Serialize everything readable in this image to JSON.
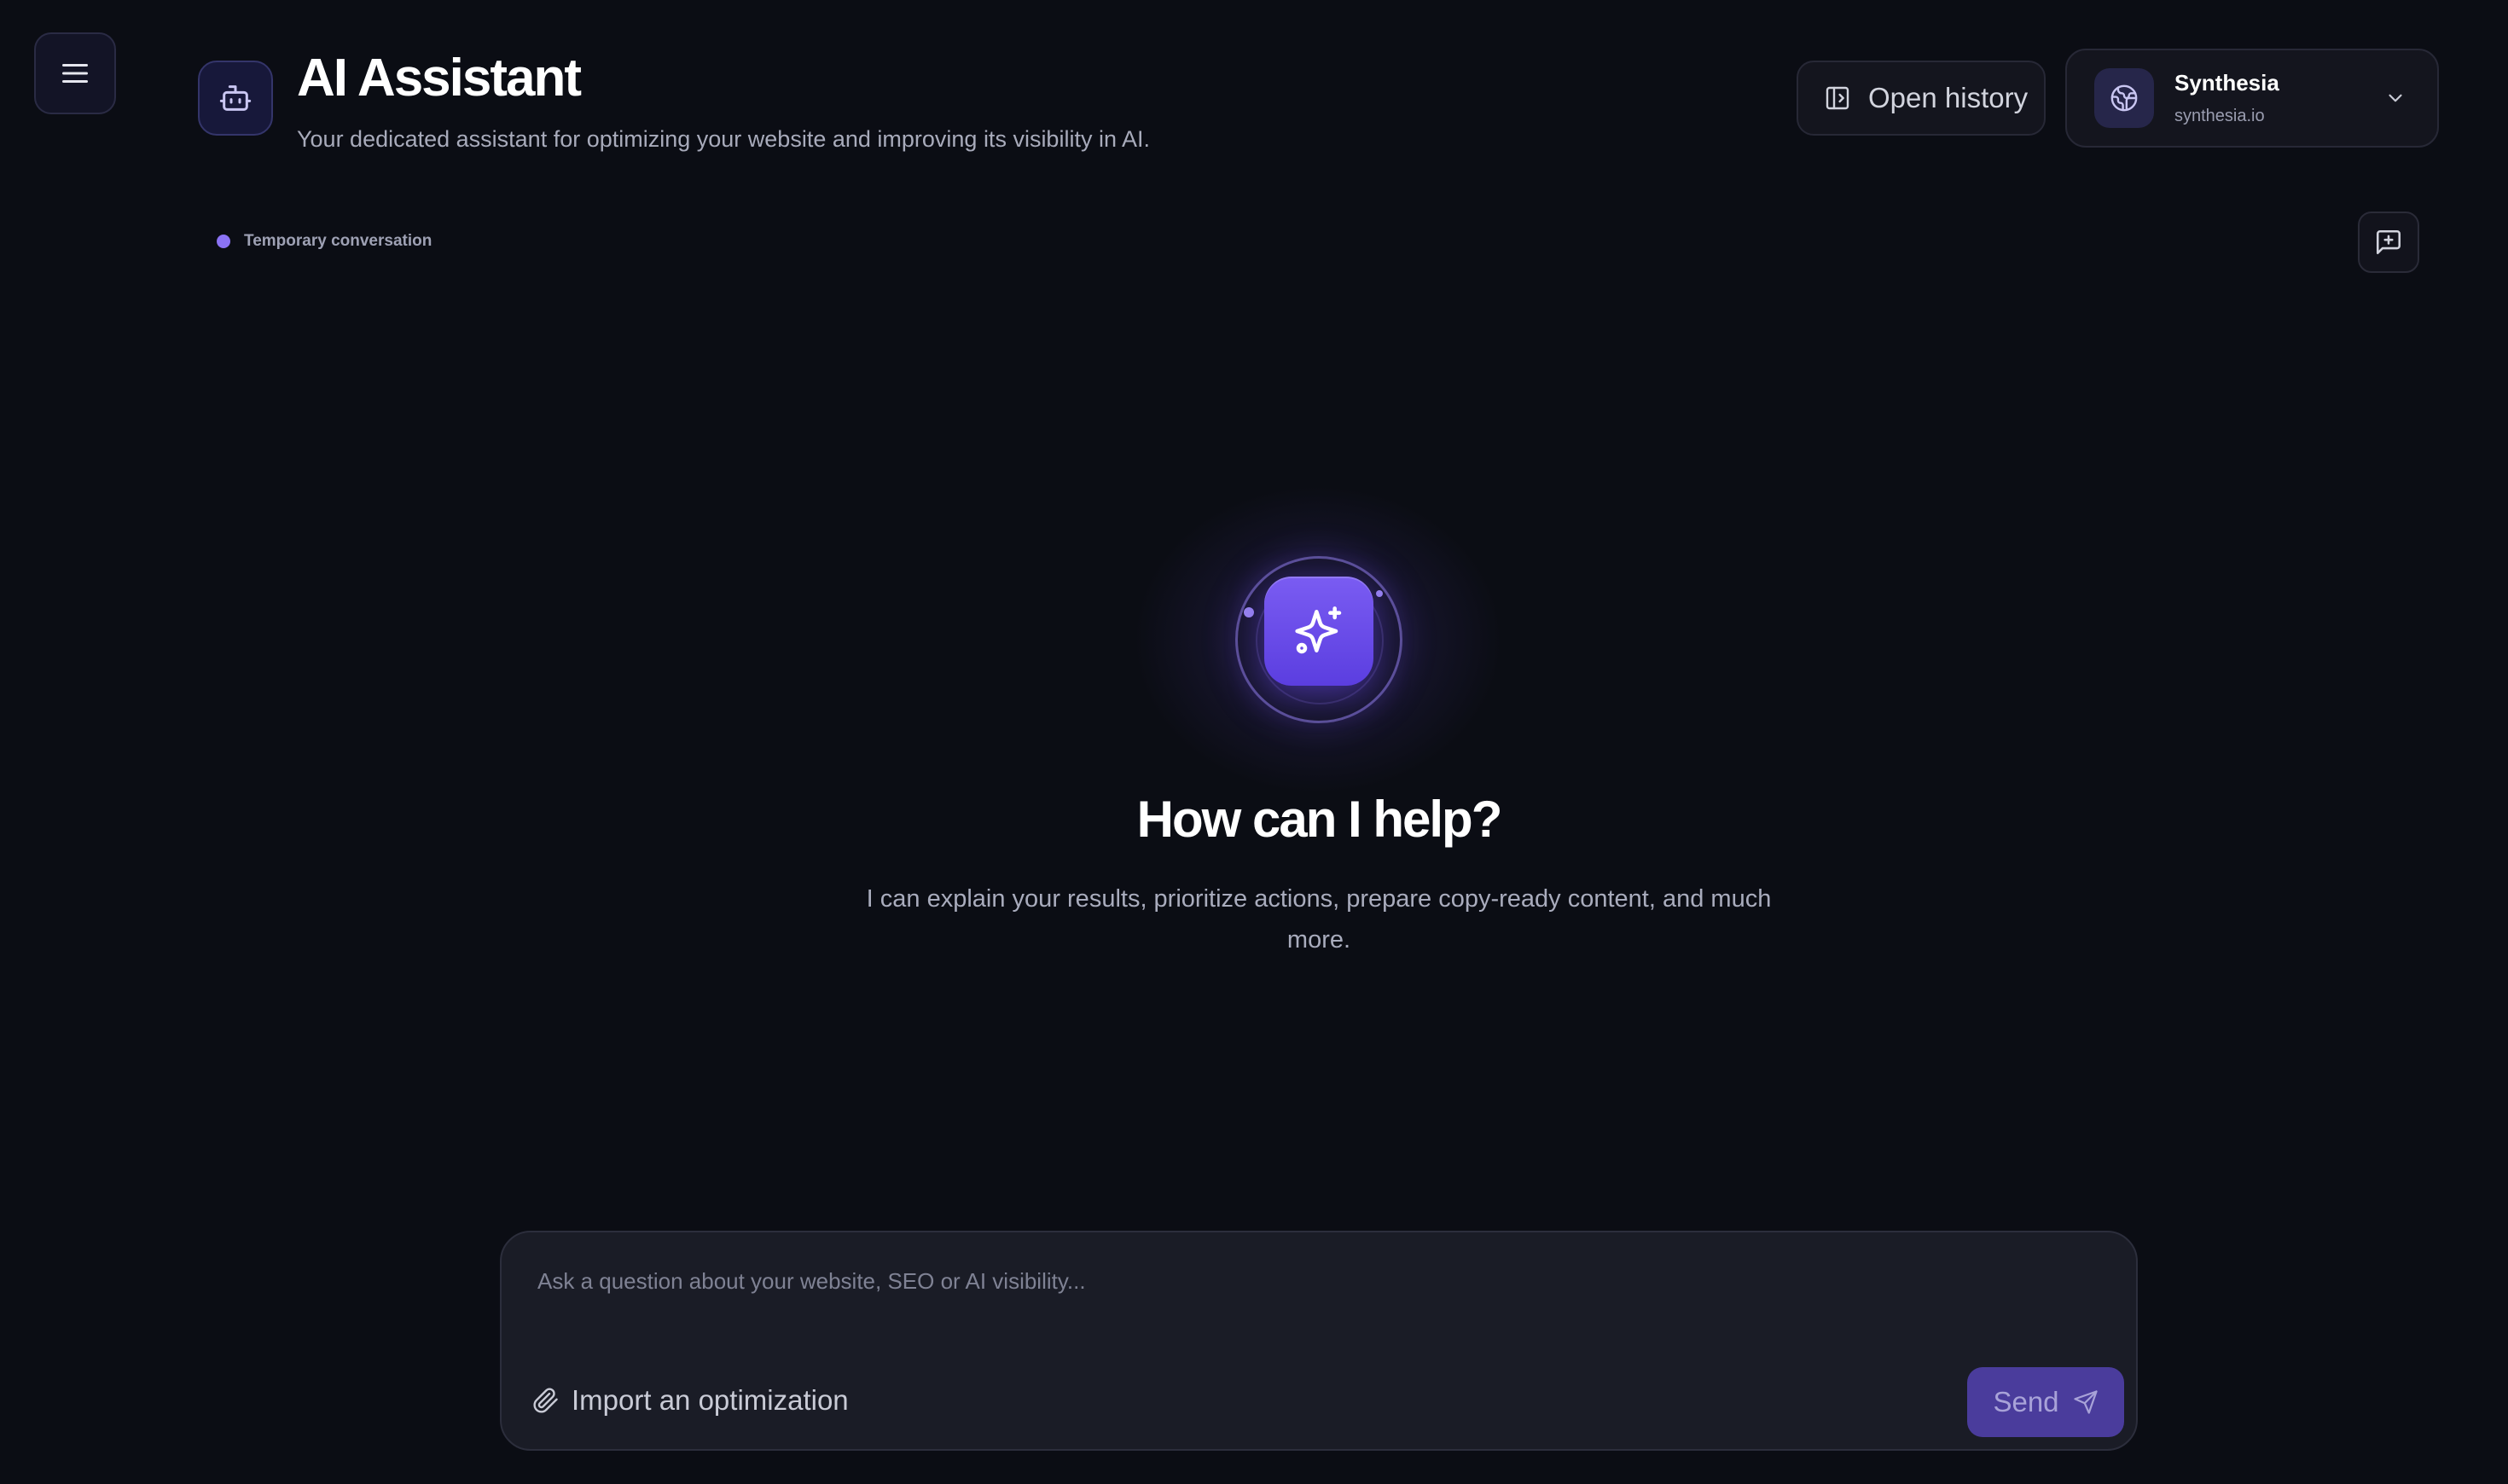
{
  "header": {
    "title": "AI Assistant",
    "subtitle": "Your dedicated assistant for optimizing your website and improving its visibility in AI.",
    "history_label": "Open history"
  },
  "site": {
    "name": "Synthesia",
    "domain": "synthesia.io"
  },
  "conversation": {
    "mode_label": "Temporary conversation"
  },
  "hero": {
    "title": "How can I help?",
    "description": "I can explain your results, prioritize actions, prepare copy-ready content, and much more."
  },
  "composer": {
    "placeholder": "Ask a question about your website, SEO or AI visibility...",
    "import_label": "Import an optimization",
    "send_label": "Send"
  },
  "colors": {
    "background": "#0b0d14",
    "accent": "#7a5cf2",
    "send_button": "#4a3c9c"
  },
  "icons": [
    "menu-icon",
    "robot-icon",
    "history-panel-icon",
    "globe-icon",
    "chevron-down-icon",
    "new-chat-icon",
    "sparkles-icon",
    "paperclip-icon",
    "send-icon"
  ]
}
